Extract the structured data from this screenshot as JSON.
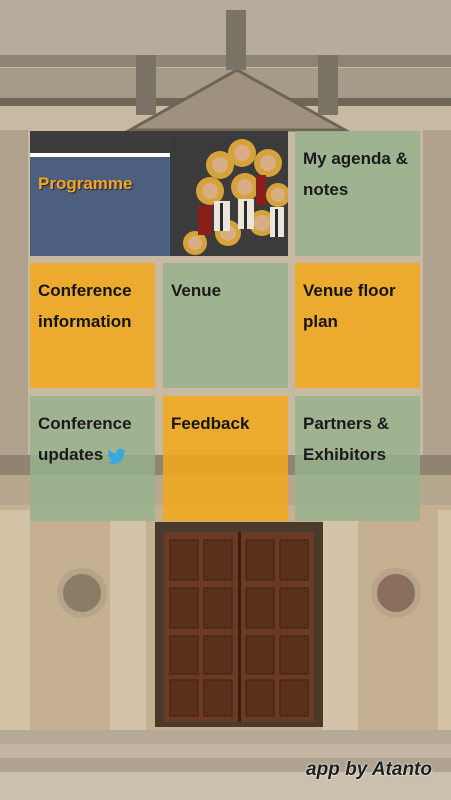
{
  "tiles": {
    "programme": "Programme",
    "agenda": "My agenda & notes",
    "conference_info": "Conference information",
    "venue": "Venue",
    "floor_plan": "Venue floor plan",
    "updates": "Conference updates",
    "feedback": "Feedback",
    "partners": "Partners & Exhibitors"
  },
  "footer": {
    "brand": "app by Atanto"
  },
  "colors": {
    "accent_orange": "#f0a81e",
    "tile_green": "#96b28e",
    "programme_blue": "#4d5f80"
  },
  "icons": {
    "updates": "twitter-bird-icon"
  }
}
